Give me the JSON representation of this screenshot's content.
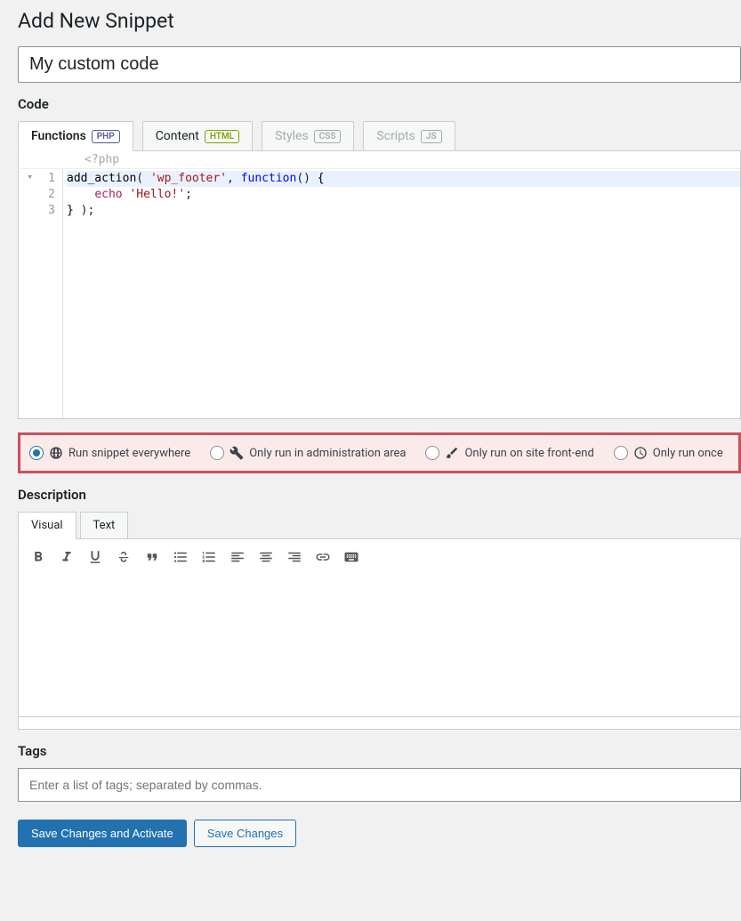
{
  "page": {
    "title": "Add New Snippet"
  },
  "snippet_title": "My custom code",
  "sections": {
    "code": "Code",
    "description": "Description",
    "tags": "Tags"
  },
  "code_tabs": {
    "functions": {
      "label": "Functions",
      "badge": "PHP"
    },
    "content": {
      "label": "Content",
      "badge": "HTML"
    },
    "styles": {
      "label": "Styles",
      "badge": "CSS"
    },
    "scripts": {
      "label": "Scripts",
      "badge": "JS"
    }
  },
  "editor": {
    "php_open": "<?php",
    "fold_mark": "▾",
    "lines": [
      "1",
      "2",
      "3"
    ],
    "line1": {
      "fn": "add_action",
      "paren_open": "( ",
      "arg1": "'wp_footer'",
      "comma": ", ",
      "kw": "function",
      "parens": "()",
      "space": " ",
      "brace": "{"
    },
    "line2": {
      "indent": "    ",
      "echo": "echo",
      "space": " ",
      "str": "'Hello!'",
      "semi": ";"
    },
    "line3": {
      "brace": "}",
      "rest": " );"
    }
  },
  "scope": {
    "everywhere": "Run snippet everywhere",
    "admin": "Only run in administration area",
    "frontend": "Only run on site front-end",
    "once": "Only run once"
  },
  "desc_tabs": {
    "visual": "Visual",
    "text": "Text"
  },
  "tags": {
    "placeholder": "Enter a list of tags; separated by commas."
  },
  "buttons": {
    "save_activate": "Save Changes and Activate",
    "save": "Save Changes"
  }
}
